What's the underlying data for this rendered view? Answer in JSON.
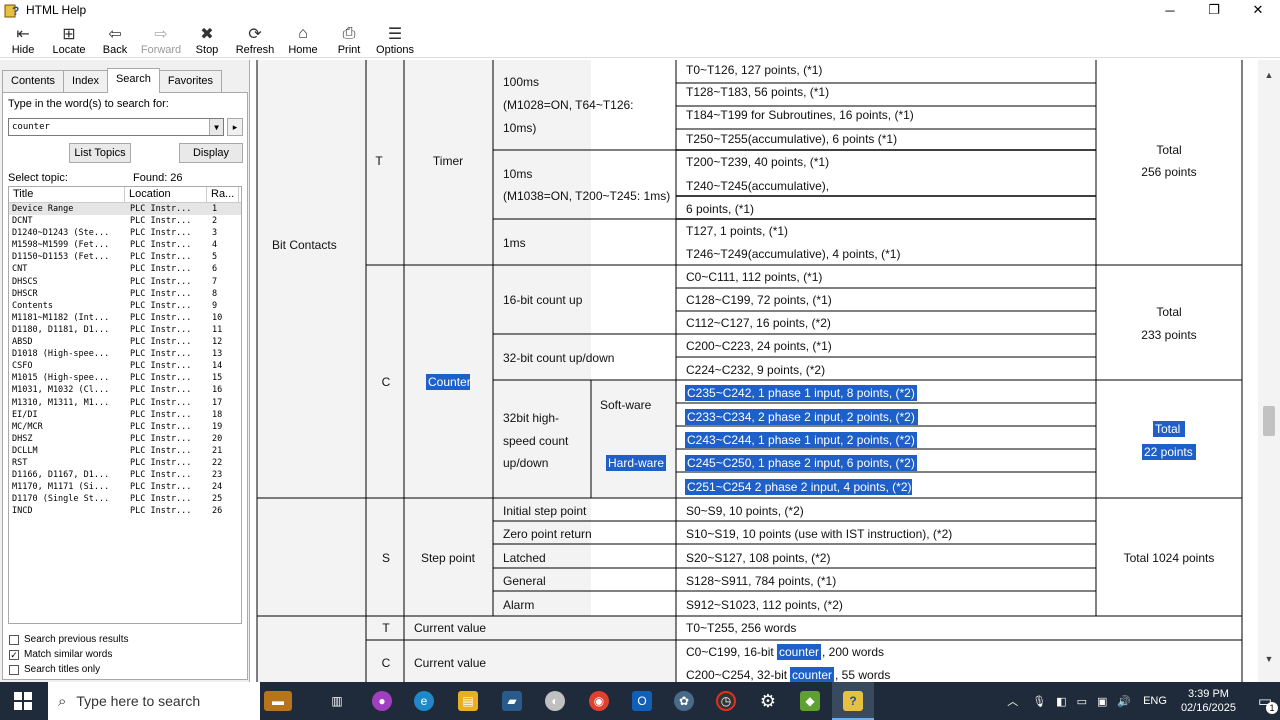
{
  "window": {
    "title": "HTML Help"
  },
  "toolbar": [
    {
      "label": "Hide",
      "icon": "hide-icon",
      "glyph": "⇤",
      "enabled": true
    },
    {
      "label": "Locate",
      "icon": "locate-icon",
      "glyph": "⊞",
      "enabled": true
    },
    {
      "label": "Back",
      "icon": "back-icon",
      "glyph": "⇦",
      "enabled": true
    },
    {
      "label": "Forward",
      "icon": "forward-icon",
      "glyph": "⇨",
      "enabled": false
    },
    {
      "label": "Stop",
      "icon": "stop-icon",
      "glyph": "✖",
      "enabled": true
    },
    {
      "label": "Refresh",
      "icon": "refresh-icon",
      "glyph": "⟳",
      "enabled": true
    },
    {
      "label": "Home",
      "icon": "home-icon",
      "glyph": "⌂",
      "enabled": true
    },
    {
      "label": "Print",
      "icon": "print-icon",
      "glyph": "⎙",
      "enabled": true
    },
    {
      "label": "Options",
      "icon": "options-icon",
      "glyph": "☰",
      "enabled": true
    }
  ],
  "nav": {
    "tabs": [
      "Contents",
      "Index",
      "Search",
      "Favorites"
    ],
    "active_tab": "Search",
    "prompt": "Type in the word(s) to search for:",
    "query": "counter",
    "list_topics": "List Topics",
    "display": "Display",
    "select_topic": "Select topic:",
    "found": "Found: 26",
    "columns": [
      "Title",
      "Location",
      "Ra..."
    ],
    "results": [
      [
        "Device Range",
        "PLC Instr...",
        "1"
      ],
      [
        "DCNT",
        "PLC Instr...",
        "2"
      ],
      [
        "D1240~D1243 (Ste...",
        "PLC Instr...",
        "3"
      ],
      [
        "M1598~M1599 (Fet...",
        "PLC Instr...",
        "4"
      ],
      [
        "D1150~D1153 (Fet...",
        "PLC Instr...",
        "5"
      ],
      [
        "CNT",
        "PLC Instr...",
        "6"
      ],
      [
        "DHSCS",
        "PLC Instr...",
        "7"
      ],
      [
        "DHSCR",
        "PLC Instr...",
        "8"
      ],
      [
        "Contents",
        "PLC Instr...",
        "9"
      ],
      [
        "M1181~M1182 (Int...",
        "PLC Instr...",
        "10"
      ],
      [
        "D1180, D1181, D1...",
        "PLC Instr...",
        "11"
      ],
      [
        "ABSD",
        "PLC Instr...",
        "12"
      ],
      [
        "D1018 (High-spee...",
        "PLC Instr...",
        "13"
      ],
      [
        "CSFO",
        "PLC Instr...",
        "14"
      ],
      [
        "M1015 (High-spee...",
        "PLC Instr...",
        "15"
      ],
      [
        "M1031, M1032 (Cl...",
        "PLC Instr...",
        "16"
      ],
      [
        "M1310, M1311, M1...",
        "PLC Instr...",
        "17"
      ],
      [
        "EI/DI",
        "PLC Instr...",
        "18"
      ],
      [
        "MC/MCR",
        "PLC Instr...",
        "19"
      ],
      [
        "DHSZ",
        "PLC Instr...",
        "20"
      ],
      [
        "DCLLM",
        "PLC Instr...",
        "21"
      ],
      [
        "RST",
        "PLC Instr...",
        "22"
      ],
      [
        "D1166, D1167, D1...",
        "PLC Instr...",
        "23"
      ],
      [
        "M1170, M1171 (Si...",
        "PLC Instr...",
        "24"
      ],
      [
        "D1170 (Single St...",
        "PLC Instr...",
        "25"
      ],
      [
        "INCD",
        "PLC Instr...",
        "26"
      ]
    ],
    "options": [
      {
        "label": "Search previous results",
        "checked": false
      },
      {
        "label": "Match similar words",
        "checked": true
      },
      {
        "label": "Search titles only",
        "checked": false
      }
    ]
  },
  "content": {
    "bit_contacts": "Bit Contacts",
    "timer": {
      "code": "T",
      "name": "Timer",
      "total": "Total",
      "total_points": "256 points",
      "groups": [
        {
          "label": [
            "100ms",
            "(M1028=ON, T64~T126:",
            "10ms)"
          ],
          "rows": [
            "T0~T126, 127 points, (*1)",
            "T128~T183, 56 points, (*1)",
            "T184~T199 for Subroutines, 16 points, (*1)",
            "T250~T255(accumulative), 6 points (*1)"
          ]
        },
        {
          "label": [
            "10ms",
            "(M1038=ON, T200~T245: 1ms)"
          ],
          "rows": [
            "T200~T239, 40 points, (*1)",
            "T240~T245(accumulative),",
            "6 points, (*1)"
          ]
        },
        {
          "label": [
            "1ms"
          ],
          "rows": [
            "T127, 1 points, (*1)",
            "T246~T249(accumulative), 4 points, (*1)"
          ]
        }
      ]
    },
    "counter": {
      "code": "C",
      "name": "Counter",
      "total": "Total",
      "total_points": "233 points",
      "g16_label": "16-bit count up",
      "g16_rows": [
        "C0~C111, 112 points, (*1)",
        "C128~C199, 72 points, (*1)",
        "C112~C127, 16 points, (*2)"
      ],
      "g32_label": "32-bit count up/down",
      "g32_rows": [
        "C200~C223, 24 points, (*1)",
        "C224~C232, 9 points, (*2)"
      ],
      "hs_label": [
        "32bit high-",
        "speed count",
        "up/down"
      ],
      "software": "Soft-ware",
      "hardware": "Hard-ware",
      "hs_rows": [
        "C235~C242, 1 phase 1 input, 8 points, (*2)",
        "C233~C234, 2 phase 2 input, 2 points, (*2)",
        "C243~C244, 1 phase 1 input, 2 points, (*2)",
        "C245~C250, 1 phase 2 input, 6 points, (*2)",
        "C251~C254 2 phase 2 input, 4 points, (*2)"
      ],
      "hs_total": "Total",
      "hs_total_points": "22 points"
    },
    "step": {
      "code": "S",
      "name": "Step point",
      "total": "Total 1024 points",
      "rows": [
        [
          "Initial step point",
          "S0~S9, 10 points, (*2)"
        ],
        [
          "Zero point return",
          "S10~S19, 10 points (use with IST instruction), (*2)"
        ],
        [
          "Latched",
          "S20~S127, 108 points, (*2)"
        ],
        [
          "General",
          "S128~S911, 784 points, (*1)"
        ],
        [
          "Alarm",
          "S912~S1023, 112 points, (*2)"
        ]
      ]
    },
    "current": {
      "t_code": "T",
      "t_label": "Current value",
      "t_row": "T0~T255, 256 words",
      "c_code": "C",
      "c_label": "Current value",
      "c_row1_pre": "C0~C199, 16-bit ",
      "c_row1_hl": "counter",
      "c_row1_post": ", 200 words",
      "c_row2_pre": "C200~C254, 32-bit ",
      "c_row2_hl": "counter",
      "c_row2_post": ", 55 words"
    }
  },
  "taskbar": {
    "search_placeholder": "Type here to search",
    "lang": "ENG",
    "time": "3:39 PM",
    "date": "02/16/2025",
    "notif_count": "1",
    "highlight_color": "#1f5fc8"
  }
}
